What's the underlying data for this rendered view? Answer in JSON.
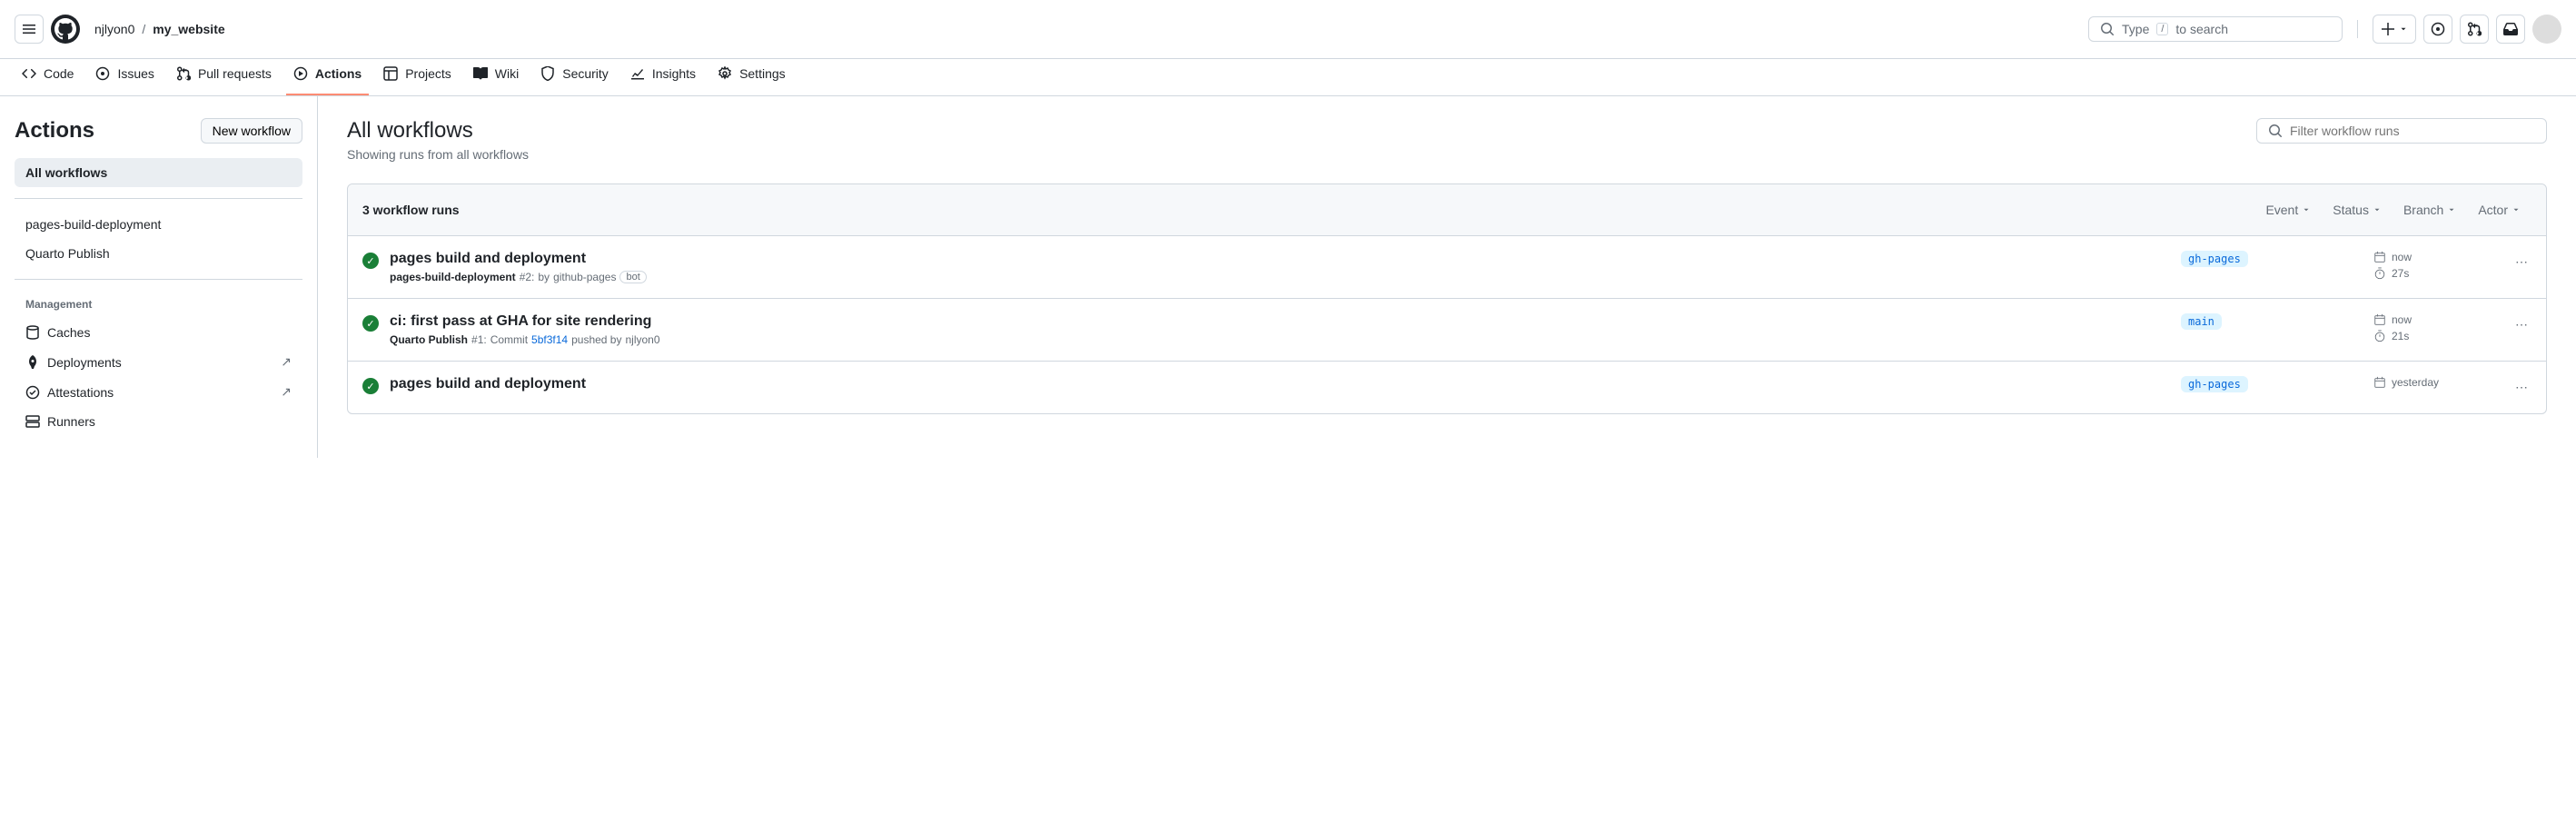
{
  "header": {
    "owner": "njlyon0",
    "sep": "/",
    "repo": "my_website",
    "search_prefix": "Type",
    "search_key": "/",
    "search_suffix": "to search"
  },
  "nav": {
    "code": "Code",
    "issues": "Issues",
    "pulls": "Pull requests",
    "actions": "Actions",
    "projects": "Projects",
    "wiki": "Wiki",
    "security": "Security",
    "insights": "Insights",
    "settings": "Settings"
  },
  "sidebar": {
    "title": "Actions",
    "new_btn": "New workflow",
    "all": "All workflows",
    "workflows": [
      "pages-build-deployment",
      "Quarto Publish"
    ],
    "mgmt_label": "Management",
    "mgmt": [
      "Caches",
      "Deployments",
      "Attestations",
      "Runners"
    ]
  },
  "content": {
    "title": "All workflows",
    "subtitle": "Showing runs from all workflows",
    "filter_placeholder": "Filter workflow runs",
    "count": "3 workflow runs",
    "filters": [
      "Event",
      "Status",
      "Branch",
      "Actor"
    ]
  },
  "runs": [
    {
      "title": "pages build and deployment",
      "workflow": "pages-build-deployment",
      "run_num": "#2:",
      "by_text": "by",
      "actor": "github-pages",
      "bot": "bot",
      "branch": "gh-pages",
      "time": "now",
      "duration": "27s"
    },
    {
      "title": "ci: first pass at GHA for site rendering",
      "workflow": "Quarto Publish",
      "run_num": "#1:",
      "commit_text": "Commit",
      "commit": "5bf3f14",
      "pushed_text": "pushed by",
      "actor": "njlyon0",
      "branch": "main",
      "time": "now",
      "duration": "21s"
    },
    {
      "title": "pages build and deployment",
      "branch": "gh-pages",
      "time": "yesterday"
    }
  ]
}
